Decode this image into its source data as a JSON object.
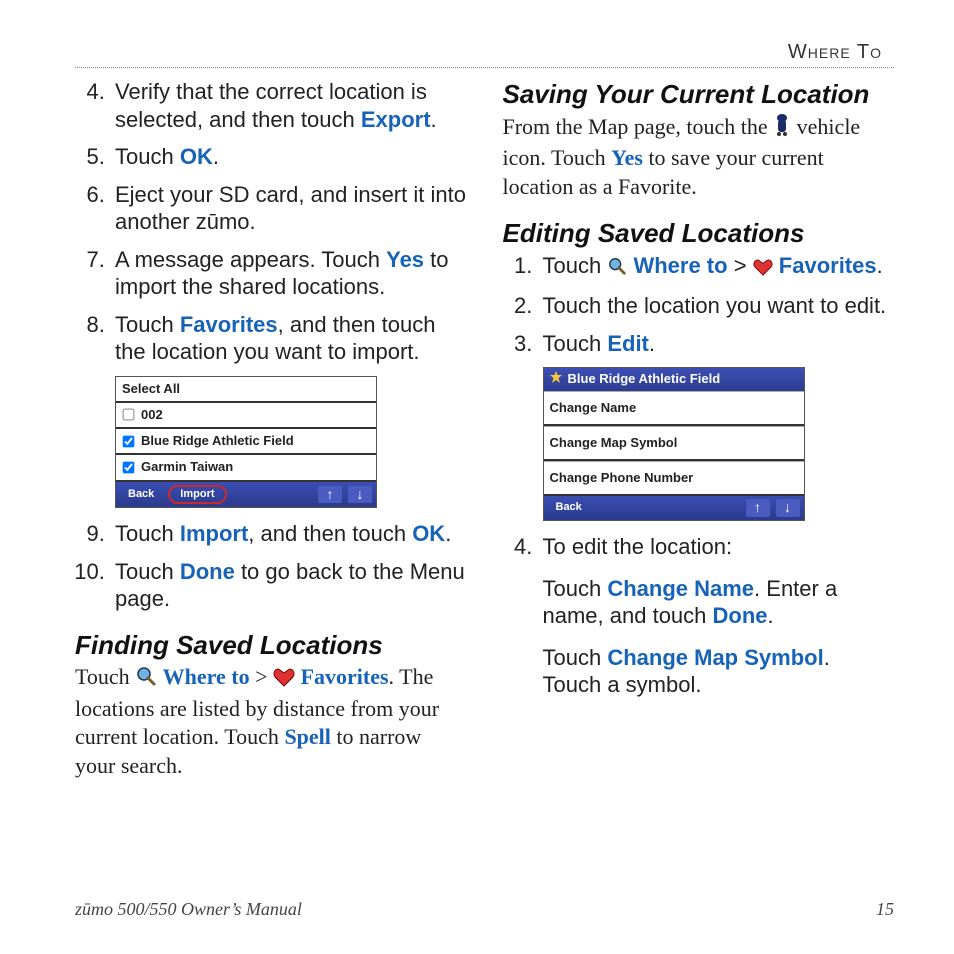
{
  "header": {
    "section": "Where To"
  },
  "col1": {
    "list1": {
      "start": 4,
      "items": [
        {
          "pre": "Verify that the correct location is selected, and then touch ",
          "bold": "Export",
          "post": "."
        },
        {
          "pre": "Touch ",
          "bold": "OK",
          "post": "."
        },
        {
          "pre": "Eject your SD card, and insert it into another zūmo."
        },
        {
          "pre": "A message appears. Touch ",
          "bold": "Yes",
          "post": " to import the shared locations."
        },
        {
          "pre": "Touch ",
          "bold": "Favorites",
          "post": ", and then touch the location you want to import."
        }
      ]
    },
    "import_widget": {
      "header": "Select All",
      "rows": [
        {
          "checked": false,
          "label": "002"
        },
        {
          "checked": true,
          "label": "Blue Ridge Athletic Field"
        },
        {
          "checked": true,
          "label": "Garmin Taiwan"
        }
      ],
      "back": "Back",
      "import": "Import"
    },
    "list2": {
      "start": 9,
      "items": [
        {
          "pre": "Touch ",
          "bold": "Import",
          "mid": ", and then touch ",
          "bold2": "OK",
          "post": "."
        },
        {
          "pre": "Touch ",
          "bold": "Done",
          "post": " to go back to the Menu page."
        }
      ]
    },
    "finding": {
      "title": "Finding Saved Locations",
      "p_pre": "Touch ",
      "where_to": "Where to",
      "gt": " > ",
      "favorites": "Favorites",
      "p_post": ". The locations are listed by distance from your current location. Touch ",
      "spell": "Spell",
      "p_tail": " to narrow your search."
    }
  },
  "col2": {
    "saving": {
      "title": "Saving Your Current Location",
      "p_pre": "From the Map page, touch the ",
      "p_mid": " vehicle icon. Touch ",
      "yes": "Yes",
      "p_post": " to save your current location as a Favorite."
    },
    "editing": {
      "title": "Editing Saved Locations",
      "list": {
        "start": 1,
        "items": [
          {
            "pre": "Touch ",
            "where_to": "Where to",
            "gt": " > ",
            "favorites": "Favorites",
            "post": "."
          },
          {
            "pre": "Touch the location you want to edit."
          },
          {
            "pre": "Touch ",
            "bold": "Edit",
            "post": "."
          }
        ]
      },
      "widget": {
        "title": "Blue Ridge Athletic Field",
        "rows": [
          "Change Name",
          "Change Map Symbol",
          "Change Phone Number"
        ],
        "back": "Back"
      },
      "step4_lead": "To edit the location:",
      "sub1_pre": "Touch ",
      "sub1_bold": "Change Name",
      "sub1_mid": ". Enter a name, and touch ",
      "sub1_bold2": "Done",
      "sub1_post": ".",
      "sub2_pre": "Touch ",
      "sub2_bold": "Change Map Symbol",
      "sub2_post": ". Touch a symbol."
    }
  },
  "footer": {
    "left": "zūmo 500/550 Owner’s Manual",
    "page": "15"
  }
}
